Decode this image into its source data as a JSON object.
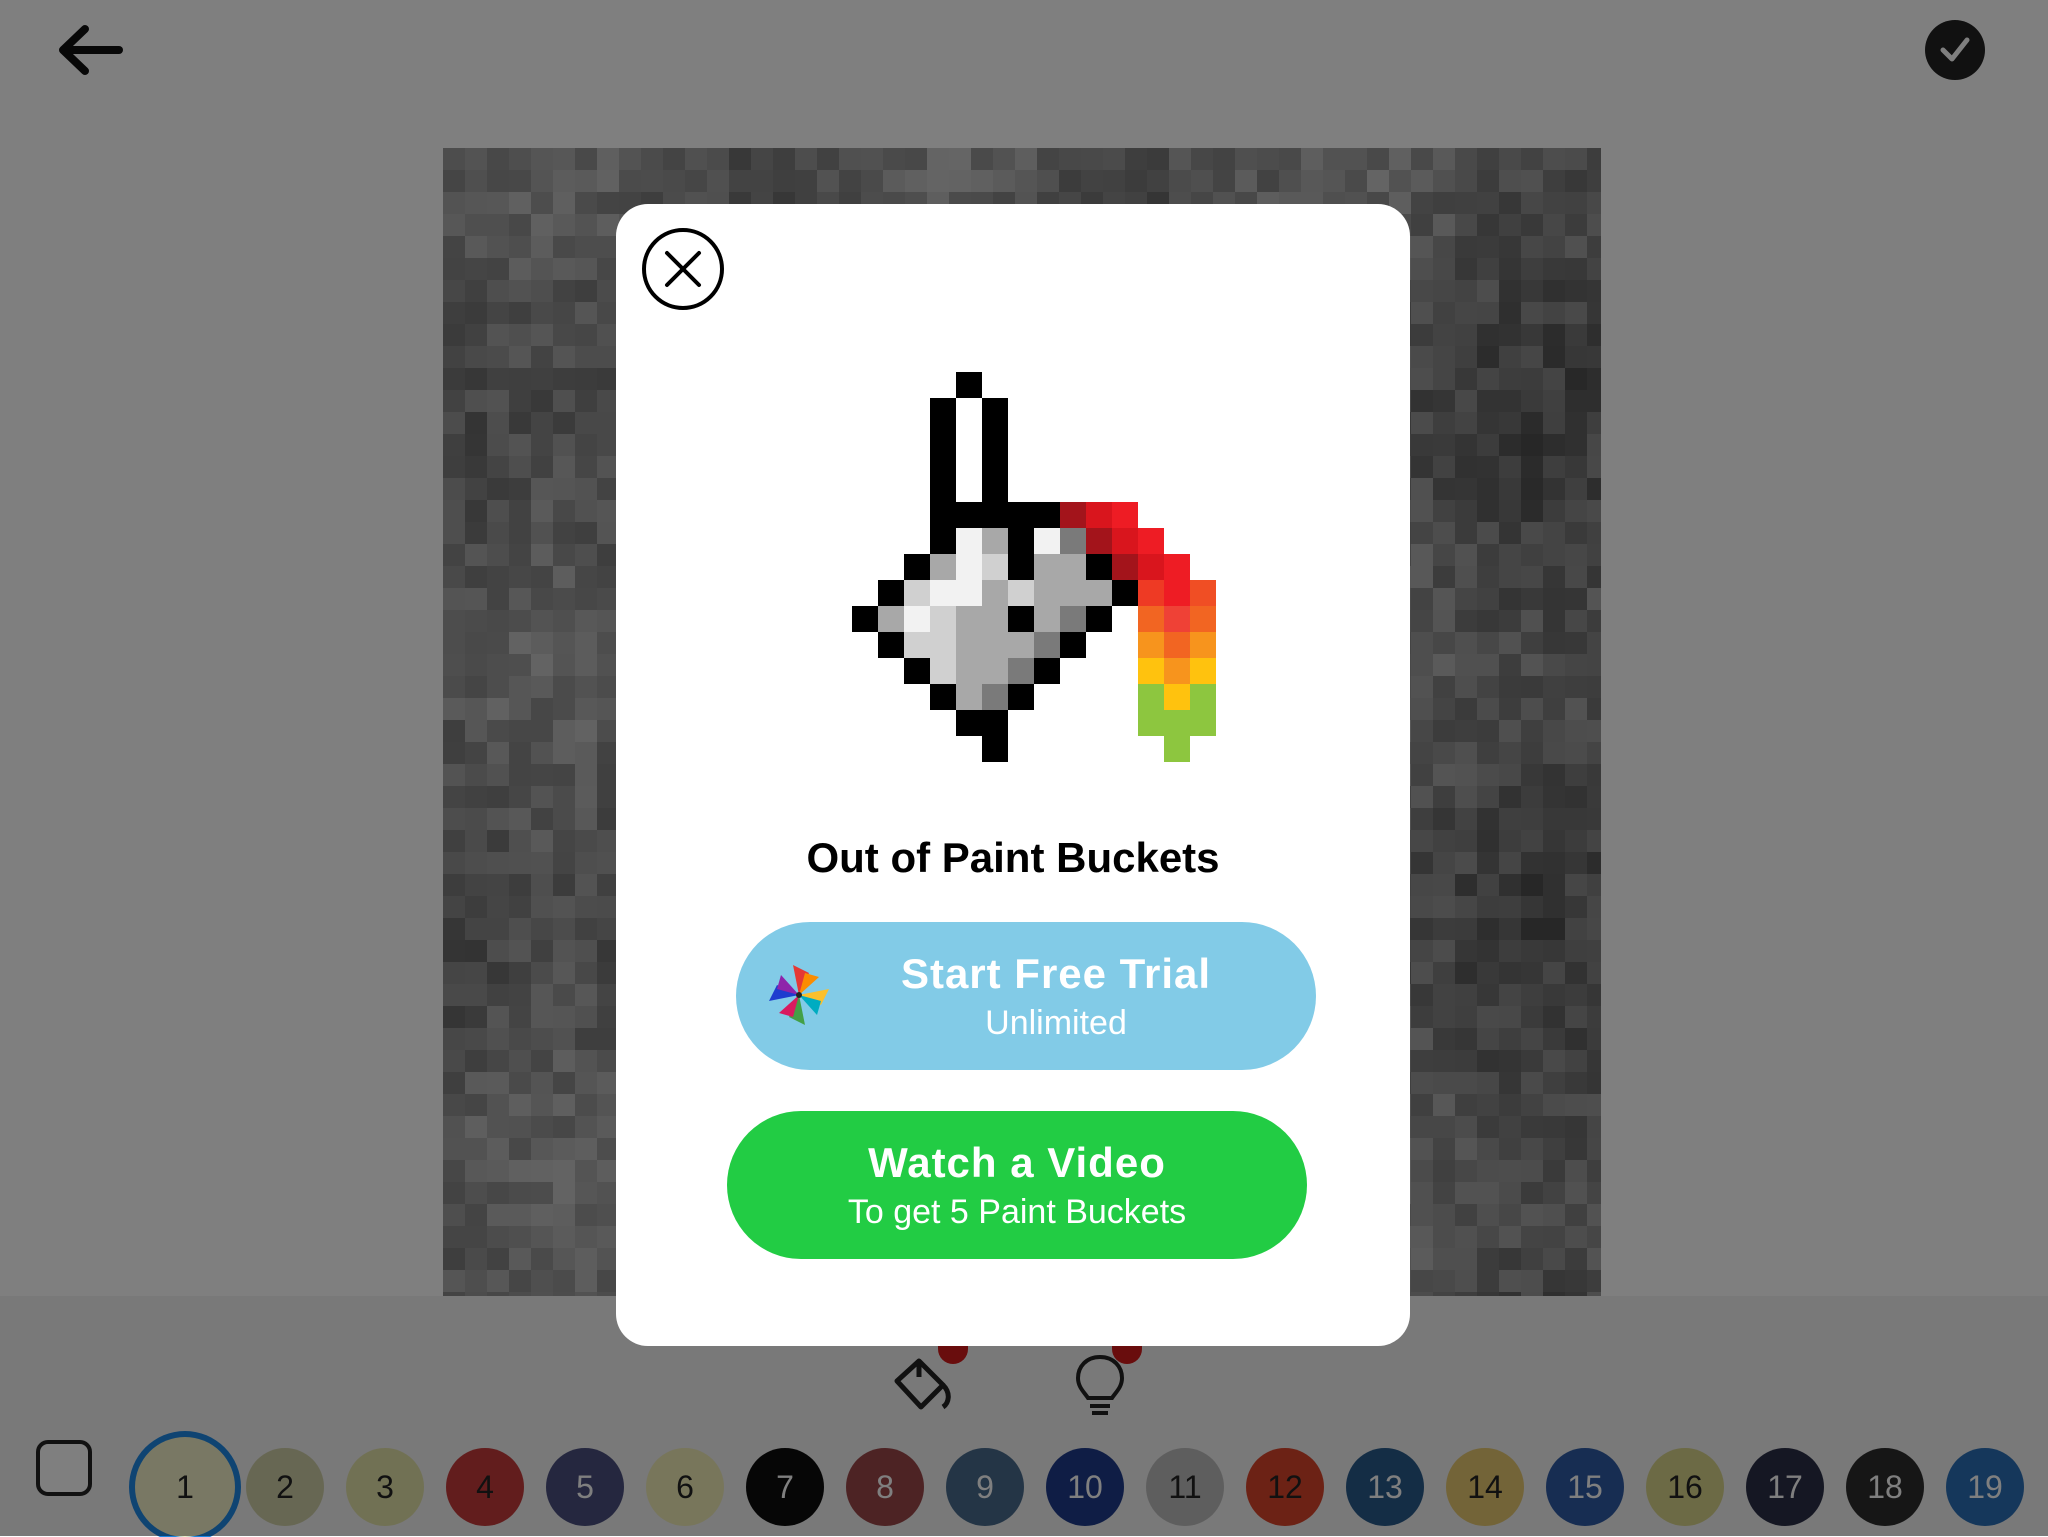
{
  "topbar": {
    "back_icon": "arrow-left-icon",
    "done_icon": "checkmark-icon"
  },
  "canvas": {
    "description_hint": "pixel-art coloring canvas (greyscale preview)"
  },
  "tools": {
    "bucket_icon": "paint-bucket-icon",
    "hint_icon": "lightbulb-icon"
  },
  "palette": {
    "selected": "1",
    "swatches": [
      {
        "label": "1",
        "color": "#f3f0c8",
        "text": "#222"
      },
      {
        "label": "2",
        "color": "#cfcfa6",
        "text": "#222"
      },
      {
        "label": "3",
        "color": "#e3e2a8",
        "text": "#222"
      },
      {
        "label": "4",
        "color": "#c43a3a",
        "text": "#222"
      },
      {
        "label": "5",
        "color": "#4a4f7e",
        "text": "#fff"
      },
      {
        "label": "6",
        "color": "#f0ecb7",
        "text": "#222"
      },
      {
        "label": "7",
        "color": "#0c0c0c",
        "text": "#fff"
      },
      {
        "label": "8",
        "color": "#9a4749",
        "text": "#fff"
      },
      {
        "label": "9",
        "color": "#496b8c",
        "text": "#fff"
      },
      {
        "label": "10",
        "color": "#1e3a8a",
        "text": "#fff"
      },
      {
        "label": "11",
        "color": "#bdbdbd",
        "text": "#222"
      },
      {
        "label": "12",
        "color": "#d9442a",
        "text": "#222"
      },
      {
        "label": "13",
        "color": "#285a8a",
        "text": "#fff"
      },
      {
        "label": "14",
        "color": "#e6c870",
        "text": "#222"
      },
      {
        "label": "15",
        "color": "#2e5aa4",
        "text": "#fff"
      },
      {
        "label": "16",
        "color": "#d8d48a",
        "text": "#222"
      },
      {
        "label": "17",
        "color": "#2a2e46",
        "text": "#fff"
      },
      {
        "label": "18",
        "color": "#2d2d2d",
        "text": "#fff"
      },
      {
        "label": "19",
        "color": "#2a6fb6",
        "text": "#fff"
      }
    ]
  },
  "modal": {
    "close_icon": "close-icon",
    "hero_icon": "paint-bucket-rainbow-icon",
    "title": "Out of Paint Buckets",
    "trial_button": {
      "title": "Start Free Trial",
      "subtitle": "Unlimited",
      "icon": "pinwheel-icon",
      "color": "#82cbe7"
    },
    "video_button": {
      "title": "Watch a Video",
      "subtitle": "To get 5 Paint Buckets",
      "color": "#22cc44"
    }
  },
  "colors": {
    "overlay": "rgba(0,0,0,0.5)",
    "accent_selected": "#1e88e5"
  }
}
